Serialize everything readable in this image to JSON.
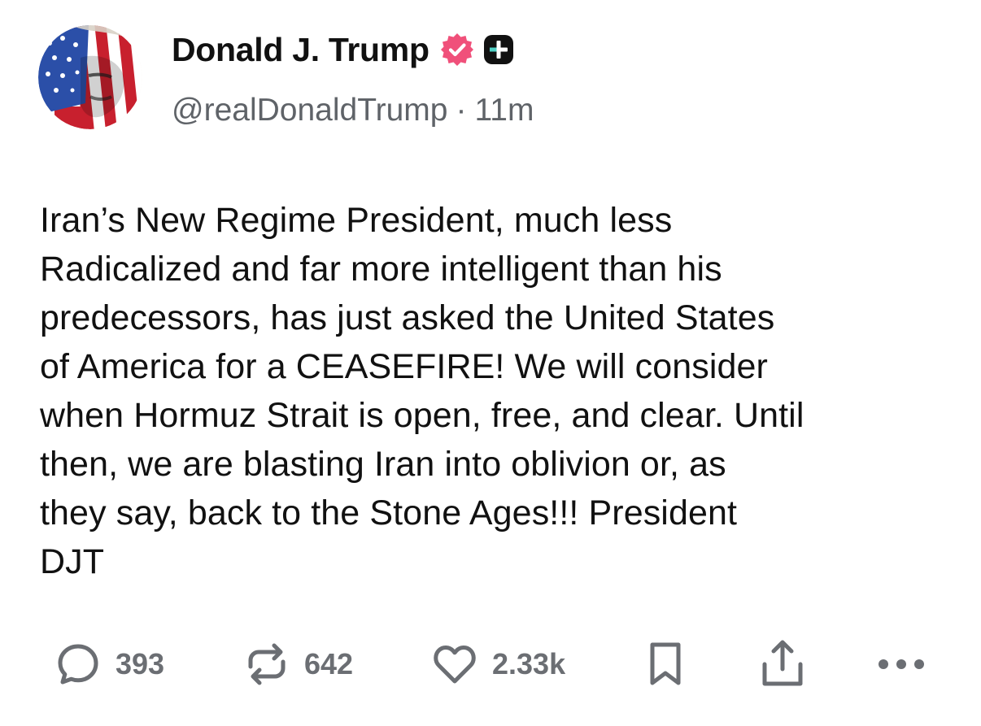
{
  "post": {
    "author": {
      "display_name": "Donald J. Trump",
      "handle": "@realDonaldTrump",
      "separator": "·",
      "time_ago": "11m",
      "verified_badge_color": "#f0507a",
      "plus_badge_color": "#111111"
    },
    "body_lines": [
      "Iran’s New Regime President, much less",
      "Radicalized and far more intelligent than his",
      "predecessors, has just asked the United States",
      "of America for a CEASEFIRE! We will consider",
      "when Hormuz Strait is open, free, and clear. Until",
      "then, we are blasting Iran into oblivion or, as",
      "they say, back to the Stone Ages!!! President",
      "DJT"
    ],
    "actions": {
      "reply_count": "393",
      "repost_count": "642",
      "like_count": "2.33k"
    },
    "icons": {
      "reply": "speech-bubble-icon",
      "repost": "repost-arrows-icon",
      "like": "heart-icon",
      "bookmark": "bookmark-icon",
      "share": "share-upload-icon",
      "more": "more-dots-icon",
      "verified": "verified-badge-icon",
      "plus": "plus-badge-icon"
    },
    "colors": {
      "text": "#111111",
      "meta": "#5f6368",
      "action": "#6b6e73"
    }
  }
}
